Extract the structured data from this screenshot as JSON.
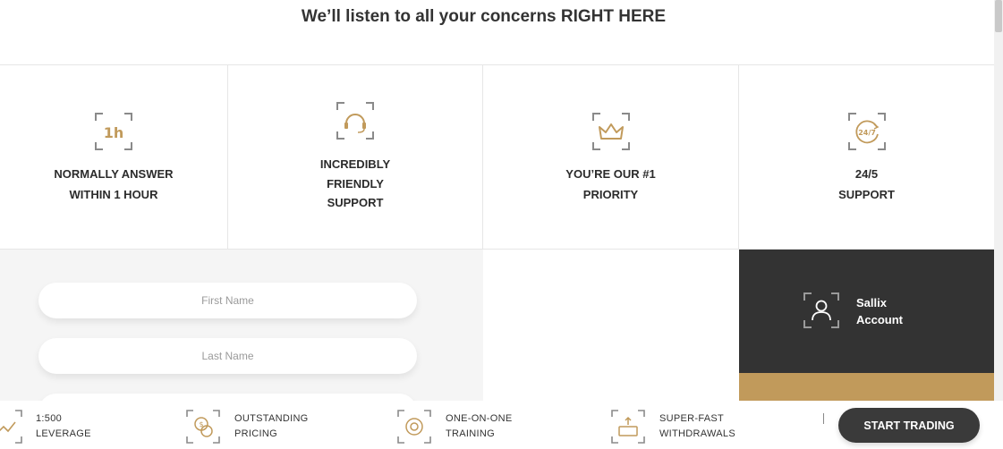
{
  "headline": {
    "prefix": "We’ll listen to all your concerns ",
    "emphasis": "RIGHT HERE"
  },
  "features": [
    {
      "icon": "one-hour-icon",
      "icon_text": "1h",
      "lines": [
        "NORMALLY ANSWER",
        "WITHIN 1 HOUR"
      ]
    },
    {
      "icon": "headset-icon",
      "lines": [
        "INCREDIBLY",
        "FRIENDLY",
        "SUPPORT"
      ]
    },
    {
      "icon": "crown-icon",
      "lines": [
        "YOU’RE OUR #1",
        "PRIORITY"
      ]
    },
    {
      "icon": "clock-24-7-icon",
      "icon_text": "24/7",
      "lines": [
        "24/5",
        "SUPPORT"
      ]
    }
  ],
  "form": {
    "first_name_placeholder": "First Name",
    "last_name_placeholder": "Last Name"
  },
  "account": {
    "line1": "Sallix",
    "line2": "Account",
    "icon": "user-icon"
  },
  "bottom_bar": {
    "items": [
      {
        "icon": "leverage-icon",
        "line1": "1:500",
        "line2": "LEVERAGE"
      },
      {
        "icon": "pricing-icon",
        "line1": "OUTSTANDING",
        "line2": "PRICING"
      },
      {
        "icon": "training-icon",
        "line1": "ONE-ON-ONE",
        "line2": "TRAINING"
      },
      {
        "icon": "withdrawal-icon",
        "line1": "SUPER-FAST",
        "line2": "WITHDRAWALS"
      }
    ],
    "cta_label": "START TRADING"
  },
  "colors": {
    "gold": "#c19a5b",
    "dark": "#333333",
    "frame_gray": "#8a8a8a",
    "form_bg": "#f5f5f5"
  }
}
